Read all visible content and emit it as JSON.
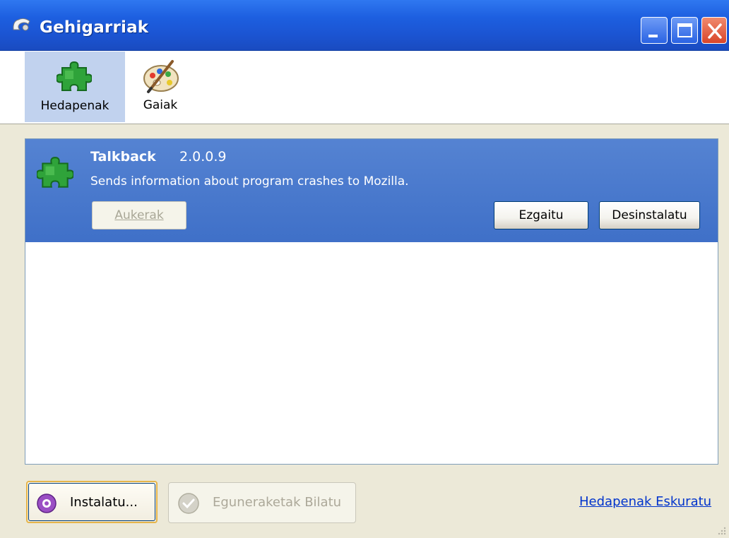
{
  "window": {
    "title": "Gehigarriak",
    "icon": "app-icon",
    "controls": [
      "minimize-icon",
      "maximize-icon",
      "close-icon"
    ]
  },
  "toolbar": {
    "items": [
      {
        "label": "Hedapenak",
        "icon": "puzzle-icon",
        "selected": true
      },
      {
        "label": "Gaiak",
        "icon": "palette-icon",
        "selected": false
      }
    ]
  },
  "extensions": [
    {
      "name": "Talkback",
      "version": "2.0.0.9",
      "description": "Sends information about program crashes to Mozilla.",
      "icon": "puzzle-icon",
      "options_label": "Aukerak",
      "disable_label": "Ezgaitu",
      "uninstall_label": "Desinstalatu"
    }
  ],
  "footer": {
    "install_label": "Instalatu...",
    "update_label": "Eguneraketak Bilatu",
    "get_link": "Hedapenak Eskuratu"
  },
  "colors": {
    "titlebar": "#1d5fe0",
    "selection": "#4a7acd",
    "toolbar_selected": "#c1d2ee",
    "link": "#0033cc"
  }
}
